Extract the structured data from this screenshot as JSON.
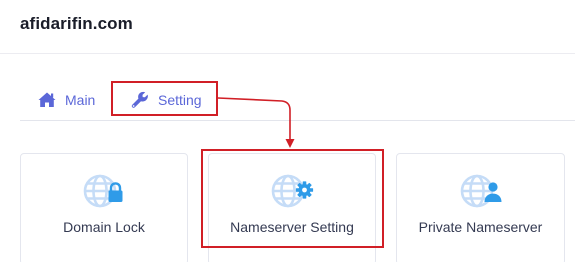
{
  "header": {
    "domain": "afidarifin.com"
  },
  "tabs": [
    {
      "label": "Main",
      "icon": "home-icon",
      "active": false
    },
    {
      "label": "Setting",
      "icon": "wrench-icon",
      "active": true
    }
  ],
  "cards": [
    {
      "label": "Domain Lock",
      "icon": "globe-lock-icon"
    },
    {
      "label": "Nameserver Setting",
      "icon": "globe-gear-icon"
    },
    {
      "label": "Private Nameserver",
      "icon": "globe-user-icon"
    }
  ],
  "colors": {
    "accent": "#5b67d8",
    "icon_globe": "#c5dcf7",
    "icon_badge": "#2f9be8",
    "highlight": "#d11f26",
    "divider": "#e3e5ec"
  }
}
